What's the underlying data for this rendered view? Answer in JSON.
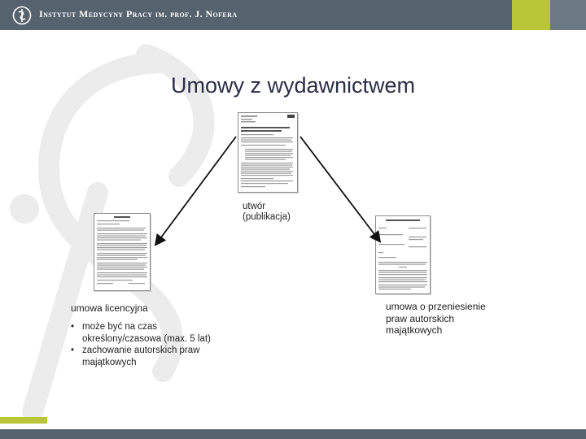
{
  "header": {
    "institution": "Instytut Medycyny Pracy im. prof. J. Nofera",
    "colors": {
      "bar": "#56636f",
      "accent": "#b9c638"
    }
  },
  "slide": {
    "title": "Umowy z wydawnictwem",
    "center_label": "utwór (publikacja)",
    "left_label": "umowa licencyjna",
    "left_bullets": [
      "może być na czas określony/czasowa (max. 5 lat)",
      "zachowanie autorskich praw majątkowych"
    ],
    "right_label": "umowa o przeniesienie praw autorskich majątkowych"
  }
}
